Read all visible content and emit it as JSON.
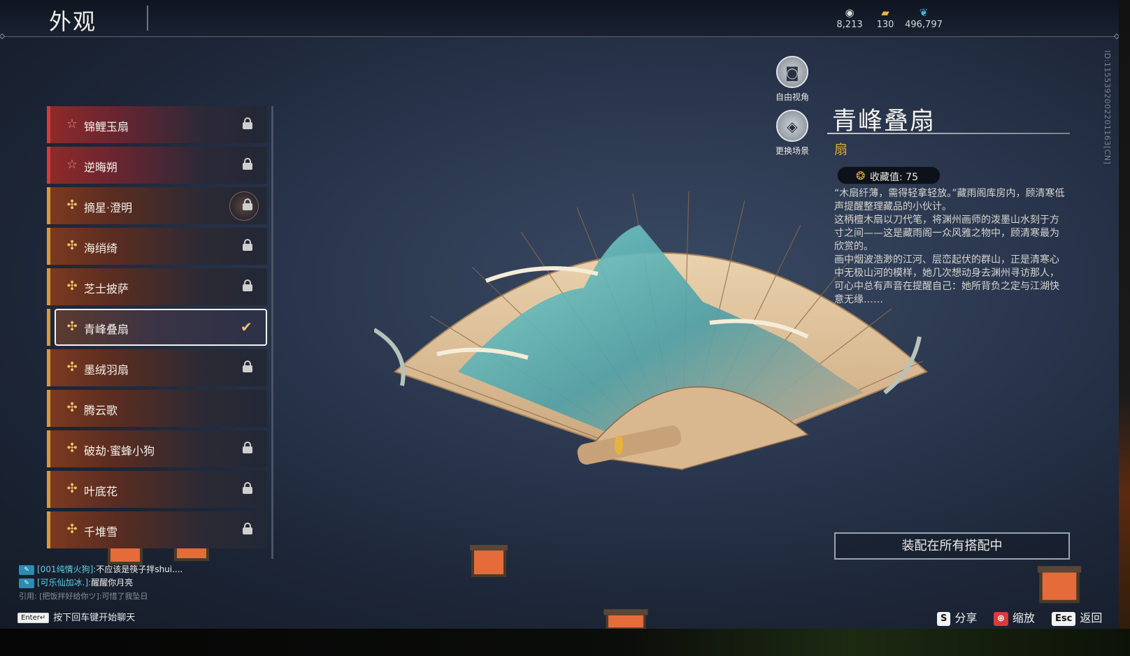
{
  "header": {
    "title": "外观",
    "currencies": [
      {
        "icon": "coin-icon",
        "value": "8,213"
      },
      {
        "icon": "ticket-icon",
        "value": "130"
      },
      {
        "icon": "feather-icon",
        "value": "496,797"
      }
    ],
    "server_id": "ID:1155392002201163[CN]"
  },
  "list": {
    "items": [
      {
        "label": "锦鲤玉扇",
        "rarity": "red",
        "locked": true
      },
      {
        "label": "逆晦朔",
        "rarity": "red",
        "locked": true
      },
      {
        "label": "摘星·澄明",
        "rarity": "gold",
        "locked": true
      },
      {
        "label": "海绡绮",
        "rarity": "gold",
        "locked": true
      },
      {
        "label": "芝士披萨",
        "rarity": "gold",
        "locked": true
      },
      {
        "label": "青峰叠扇",
        "rarity": "gold",
        "locked": false,
        "selected": true
      },
      {
        "label": "墨绒羽扇",
        "rarity": "gold",
        "locked": true
      },
      {
        "label": "腾云歌",
        "rarity": "gold",
        "locked": false
      },
      {
        "label": "破劫·蜜蜂小狗",
        "rarity": "gold",
        "locked": true
      },
      {
        "label": "叶底花",
        "rarity": "gold",
        "locked": true
      },
      {
        "label": "千堆雪",
        "rarity": "gold",
        "locked": true
      }
    ]
  },
  "camera": {
    "free_view_label": "自由视角",
    "change_scene_label": "更换场景"
  },
  "detail": {
    "title": "青峰叠扇",
    "type": "扇",
    "collect_label": "收藏值: 75",
    "description": [
      "“木扇纤薄，需得轻拿轻放。”藏雨阁库房内，顾清寒低声提醒整理藏品的小伙计。",
      "这柄檀木扇以刀代笔，将渊州画师的泼墨山水刻于方寸之间——这是藏雨阁一众风雅之物中，顾清寒最为欣赏的。",
      "画中烟波浩渺的江河、层峦起伏的群山，正是清寒心中无极山河的模样，她几次想动身去渊州寻访那人，可心中总有声音在提醒自己：她所背负之定与江湖快意无缘……"
    ],
    "equip_button": "装配在所有搭配中"
  },
  "chat": {
    "messages": [
      {
        "name": "[001纯情火狗]:",
        "text": "不应该是筷子拌shui...."
      },
      {
        "name": "[可乐仙加冰.]:",
        "text": "醒醒你月亮"
      }
    ],
    "quote": "引用: [把饭拌好给你ツ]:可惜了我坠日",
    "enter_key": "Enter↵",
    "hint": "按下回车键开始聊天"
  },
  "hotkeys": [
    {
      "key": "S",
      "label": "分享"
    },
    {
      "key": "⊕",
      "label": "缩放"
    },
    {
      "key": "Esc",
      "label": "返回"
    }
  ],
  "colors": {
    "accent_gold": "#e0a53c",
    "accent_red": "#d43b3b",
    "chat_name": "#5fd0e8"
  }
}
